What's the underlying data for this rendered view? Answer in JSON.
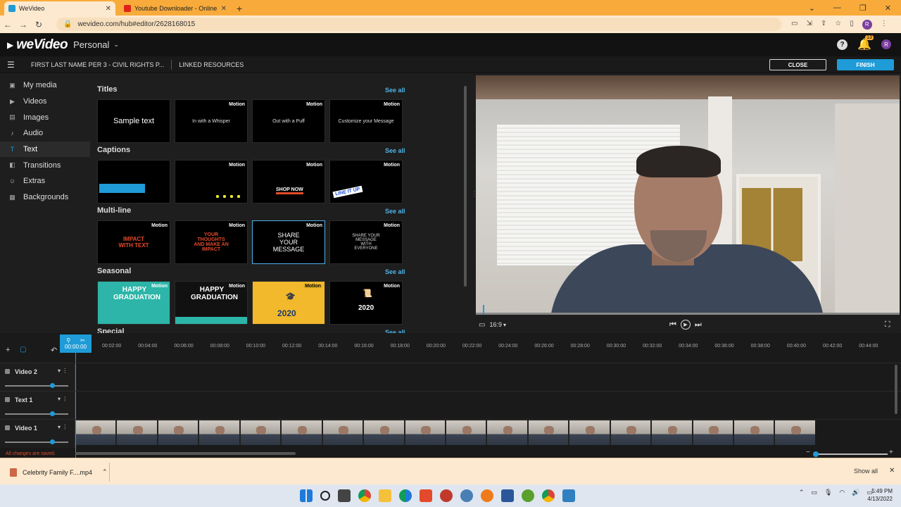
{
  "browser": {
    "tabs": [
      {
        "title": "WeVideo",
        "favicon_color": "#1f9bd7"
      },
      {
        "title": "Youtube Downloader - Online Yo",
        "favicon_color": "#e0231a"
      }
    ],
    "url": "wevideo.com/hub#editor/2628168015",
    "profile_initial": "R"
  },
  "app": {
    "logo": "weVideo",
    "workspace": "Personal",
    "notifications_count": "13",
    "help_icon": "question-icon",
    "profile_initial": "R"
  },
  "project": {
    "title": "FIRST LAST NAME PER 3 - CIVIL RIGHTS P...",
    "linked_resources": "LINKED RESOURCES",
    "close_label": "CLOSE",
    "finish_label": "FINISH"
  },
  "sidebar": {
    "items": [
      {
        "label": "My media",
        "icon": "folder-icon"
      },
      {
        "label": "Videos",
        "icon": "film-icon"
      },
      {
        "label": "Images",
        "icon": "image-icon"
      },
      {
        "label": "Audio",
        "icon": "music-icon"
      },
      {
        "label": "Text",
        "icon": "text-icon"
      },
      {
        "label": "Transitions",
        "icon": "transition-icon"
      },
      {
        "label": "Extras",
        "icon": "smiley-icon"
      },
      {
        "label": "Backgrounds",
        "icon": "background-icon"
      }
    ]
  },
  "library": {
    "see_all": "See all",
    "motion": "Motion",
    "sections": [
      {
        "title": "Titles",
        "thumbs": [
          "Sample text",
          "In with a Whisper",
          "Out with a Puff",
          "Customize your Message"
        ]
      },
      {
        "title": "Captions",
        "thumbs": [
          "",
          "",
          "SHOP NOW",
          "LINE IT UP"
        ]
      },
      {
        "title": "Multi-line",
        "thumbs": [
          "IMPACT WITH TEXT",
          "YOUR THOUGHTS AND MAKE AN IMPACT",
          "SHARE YOUR MESSAGE",
          "SHARE YOUR MESSAGE WITH EVERYONE"
        ]
      },
      {
        "title": "Seasonal",
        "thumbs": [
          "HAPPY GRADUATION",
          "HAPPY GRADUATION",
          "2020",
          "2020"
        ]
      },
      {
        "title": "Special",
        "thumbs": []
      }
    ]
  },
  "preview": {
    "aspect": "16:9"
  },
  "timeline": {
    "playhead_time": "00:00:00",
    "ticks": [
      "00:02:00",
      "00:04:00",
      "00:06:00",
      "00:08:00",
      "00:10:00",
      "00:12:00",
      "00:14:00",
      "00:16:00",
      "00:18:00",
      "00:20:00",
      "00:22:00",
      "00:24:00",
      "00:26:00",
      "00:28:00",
      "00:30:00",
      "00:32:00",
      "00:34:00",
      "00:36:00",
      "00:38:00",
      "00:40:00",
      "00:42:00",
      "00:44:00"
    ],
    "tracks": [
      {
        "name": "Video 2"
      },
      {
        "name": "Text 1"
      },
      {
        "name": "Video 1"
      }
    ],
    "saved_status": "All changes are saved."
  },
  "downloads": {
    "file": "Celebrity Family F....mp4",
    "show_all": "Show all"
  },
  "taskbar": {
    "time": "5:49 PM",
    "date": "4/13/2022"
  }
}
